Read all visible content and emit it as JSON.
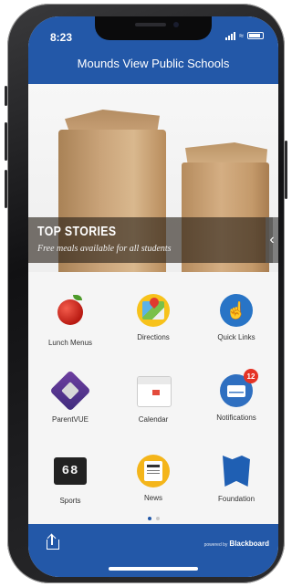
{
  "status": {
    "time": "8:23"
  },
  "header": {
    "title": "Mounds View Public Schools"
  },
  "hero": {
    "heading": "TOP STORIES",
    "subheading": "Free meals available for all students"
  },
  "tiles": [
    {
      "label": "Lunch Menus",
      "icon": "apple-icon"
    },
    {
      "label": "Directions",
      "icon": "map-icon"
    },
    {
      "label": "Quick Links",
      "icon": "pointer-icon"
    },
    {
      "label": "ParentVUE",
      "icon": "parentvue-icon"
    },
    {
      "label": "Calendar",
      "icon": "calendar-icon"
    },
    {
      "label": "Notifications",
      "icon": "envelope-icon",
      "badge": "12"
    },
    {
      "label": "Sports",
      "icon": "scoreboard-icon",
      "glyph": "68"
    },
    {
      "label": "News",
      "icon": "newspaper-icon"
    },
    {
      "label": "Foundation",
      "icon": "book-icon"
    }
  ],
  "footer": {
    "powered_by": "powered by",
    "brand": "Blackboard"
  },
  "colors": {
    "brand_blue": "#2358a8",
    "badge_red": "#e53325",
    "accent_yellow": "#f4b51a"
  }
}
